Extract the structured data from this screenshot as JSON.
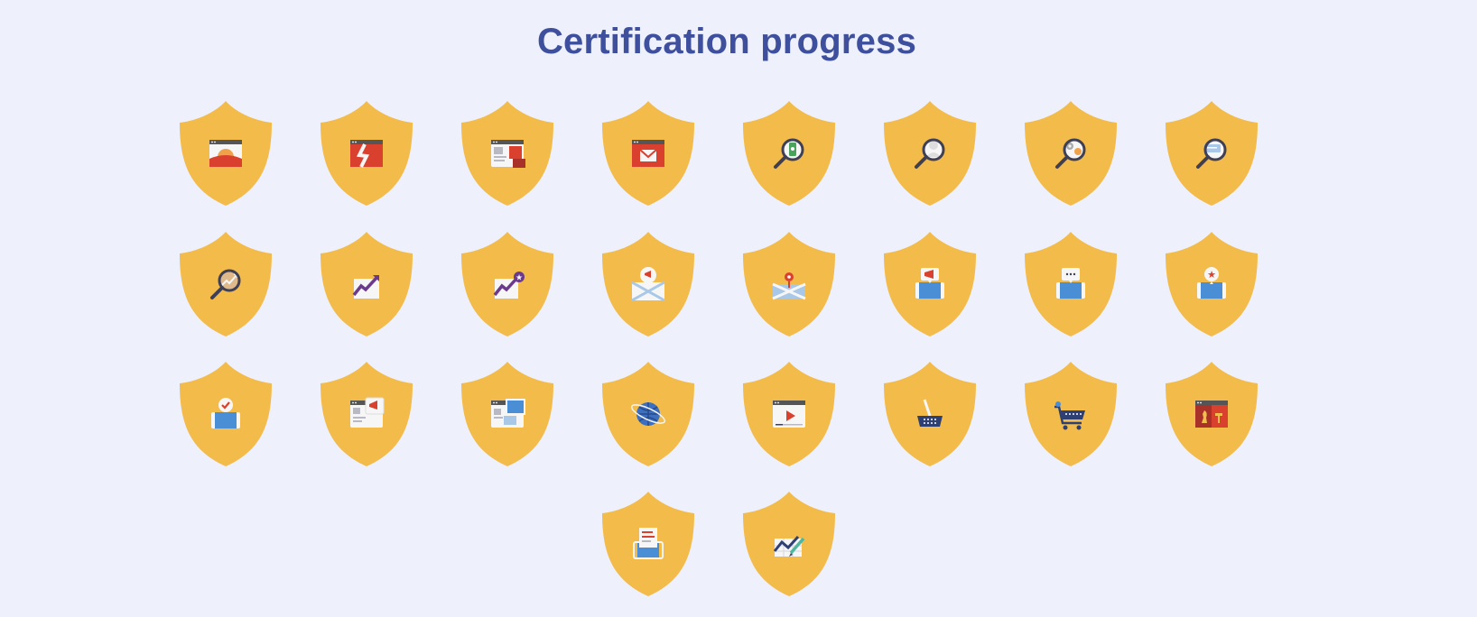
{
  "page": {
    "title": "Certification progress"
  },
  "colors": {
    "background": "#eef0fb",
    "title": "#3d4f9d",
    "shield": "#f2bb4a"
  },
  "badges": [
    {
      "icon": "sunset-window-icon"
    },
    {
      "icon": "broken-window-icon"
    },
    {
      "icon": "layout-puzzle-icon"
    },
    {
      "icon": "email-window-icon"
    },
    {
      "icon": "search-mobile-icon"
    },
    {
      "icon": "search-user-icon"
    },
    {
      "icon": "search-settings-icon"
    },
    {
      "icon": "search-text-icon"
    },
    {
      "icon": "search-growth-icon"
    },
    {
      "icon": "growth-chart-icon"
    },
    {
      "icon": "growth-star-icon"
    },
    {
      "icon": "map-megaphone-icon"
    },
    {
      "icon": "map-pin-icon"
    },
    {
      "icon": "mobile-megaphone-icon"
    },
    {
      "icon": "mobile-chat-icon"
    },
    {
      "icon": "mobile-star-icon"
    },
    {
      "icon": "mobile-check-icon"
    },
    {
      "icon": "window-megaphone-icon"
    },
    {
      "icon": "multi-screen-icon"
    },
    {
      "icon": "globe-orbit-icon"
    },
    {
      "icon": "video-player-icon"
    },
    {
      "icon": "shopping-basket-icon"
    },
    {
      "icon": "shopping-cart-icon"
    },
    {
      "icon": "chess-window-icon"
    },
    {
      "icon": "mobile-article-icon"
    },
    {
      "icon": "analytics-chart-icon"
    }
  ]
}
